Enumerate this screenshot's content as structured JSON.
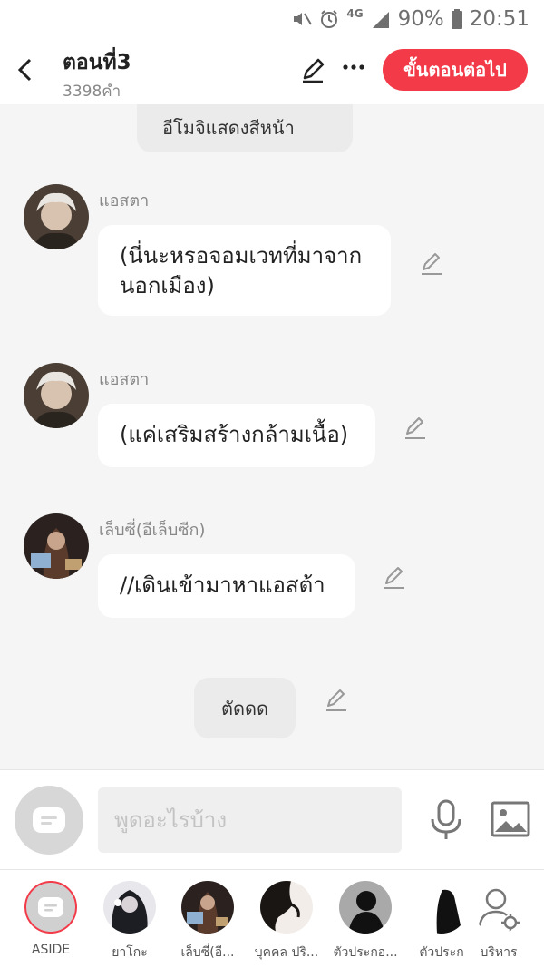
{
  "status_bar": {
    "network": "4G",
    "battery": "90%",
    "time": "20:51"
  },
  "header": {
    "title": "ตอนที่3",
    "word_count": "3398คำ",
    "next_button": "ขั้นตอนต่อไป"
  },
  "chat": {
    "system_top": {
      "clipped_line": "(…) …",
      "text": "อีโมจิแสดงสีหน้า"
    },
    "messages": [
      {
        "sender": "แอสตา",
        "text_line1": "(นี่นะหรอจอมเวทที่มาจาก",
        "text_line2": "นอกเมือง)"
      },
      {
        "sender": "แอสตา",
        "text": "(แค่เสริมสร้างกล้ามเนื้อ)"
      },
      {
        "sender": "เล็บซี่(อีเล็บซีก)",
        "text": "//เดินเข้ามาหาแอสต้า"
      }
    ],
    "system_bottom": "ตัดดด"
  },
  "composer": {
    "placeholder": "พูดอะไรบ้าง"
  },
  "characters": [
    {
      "label": "ASIDE"
    },
    {
      "label": "ยาโกะ"
    },
    {
      "label": "เล็บซี่(อี..."
    },
    {
      "label": "บุคคล ปริ..."
    },
    {
      "label": "ตัวประกอ..."
    },
    {
      "label": "ตัวประก"
    },
    {
      "label": "บริหาร"
    }
  ],
  "colors": {
    "accent": "#f23a49",
    "background": "#f5f5f5",
    "bubble": "#ffffff",
    "system_bubble": "#ebebeb"
  }
}
